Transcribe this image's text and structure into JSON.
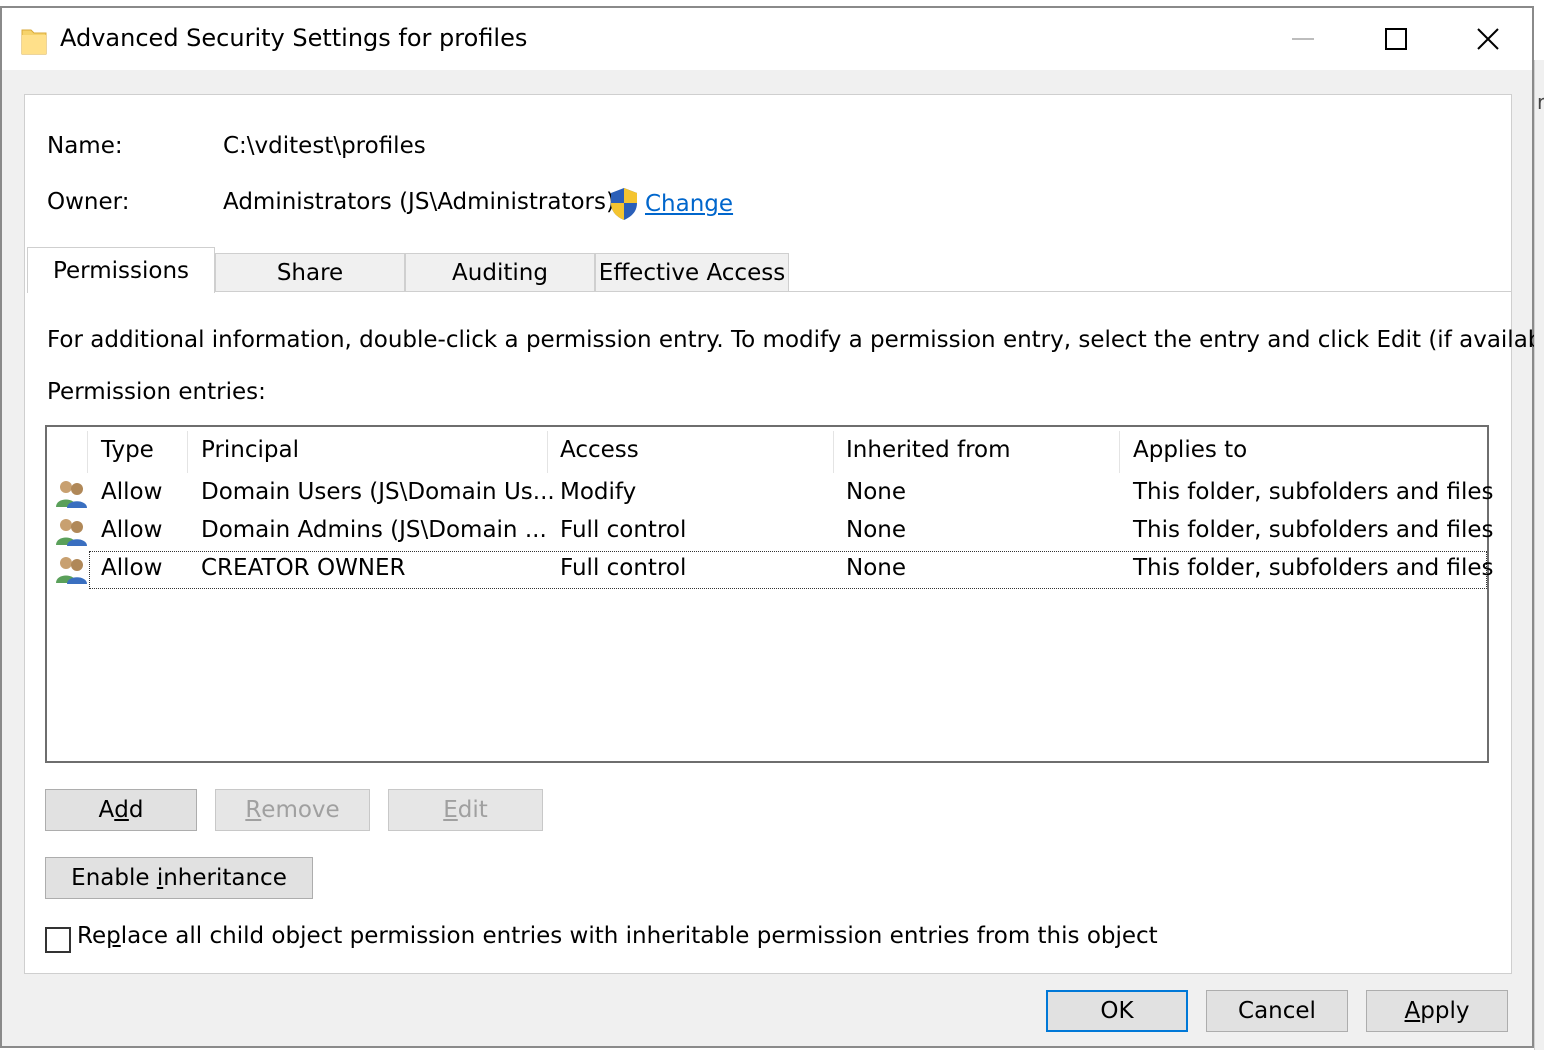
{
  "window": {
    "title": "Advanced Security Settings for profiles"
  },
  "side_glyph": "r",
  "info": {
    "name_label": "Name:",
    "name_value": "C:\\vditest\\profiles",
    "owner_label": "Owner:",
    "owner_value": "Administrators (JS\\Administrators)",
    "change_label": "Change"
  },
  "tabs": [
    {
      "label": "Permissions",
      "active": true
    },
    {
      "label": "Share",
      "active": false
    },
    {
      "label": "Auditing",
      "active": false
    },
    {
      "label": "Effective Access",
      "active": false
    }
  ],
  "instructions": "For additional information, double-click a permission entry. To modify a permission entry, select the entry and click Edit (if available).",
  "entries_label": "Permission entries:",
  "table": {
    "columns": [
      "Type",
      "Principal",
      "Access",
      "Inherited from",
      "Applies to"
    ],
    "rows": [
      {
        "type": "Allow",
        "principal": "Domain Users (JS\\Domain Us...",
        "access": "Modify",
        "inherited": "None",
        "applies": "This folder, subfolders and files"
      },
      {
        "type": "Allow",
        "principal": "Domain Admins (JS\\Domain ...",
        "access": "Full control",
        "inherited": "None",
        "applies": "This folder, subfolders and files"
      },
      {
        "type": "Allow",
        "principal": "CREATOR OWNER",
        "access": "Full control",
        "inherited": "None",
        "applies": "This folder, subfolders and files"
      }
    ]
  },
  "buttons": {
    "add": {
      "pre": "A",
      "key": "d",
      "post": "d"
    },
    "remove": {
      "pre": "",
      "key": "R",
      "post": "emove"
    },
    "edit": {
      "pre": "",
      "key": "E",
      "post": "dit"
    },
    "enable_inheritance": {
      "pre": "Enable ",
      "key": "i",
      "post": "nheritance"
    },
    "ok": "OK",
    "cancel": "Cancel",
    "apply": {
      "pre": "",
      "key": "A",
      "post": "pply"
    }
  },
  "replace_checkbox": {
    "pre": "Re",
    "key": "p",
    "post": "lace all child object permission entries with inheritable permission entries from this object",
    "checked": false
  },
  "colors": {
    "link": "#0066cc",
    "focus_border": "#0078d7",
    "disabled_text": "#a0a0a0"
  }
}
